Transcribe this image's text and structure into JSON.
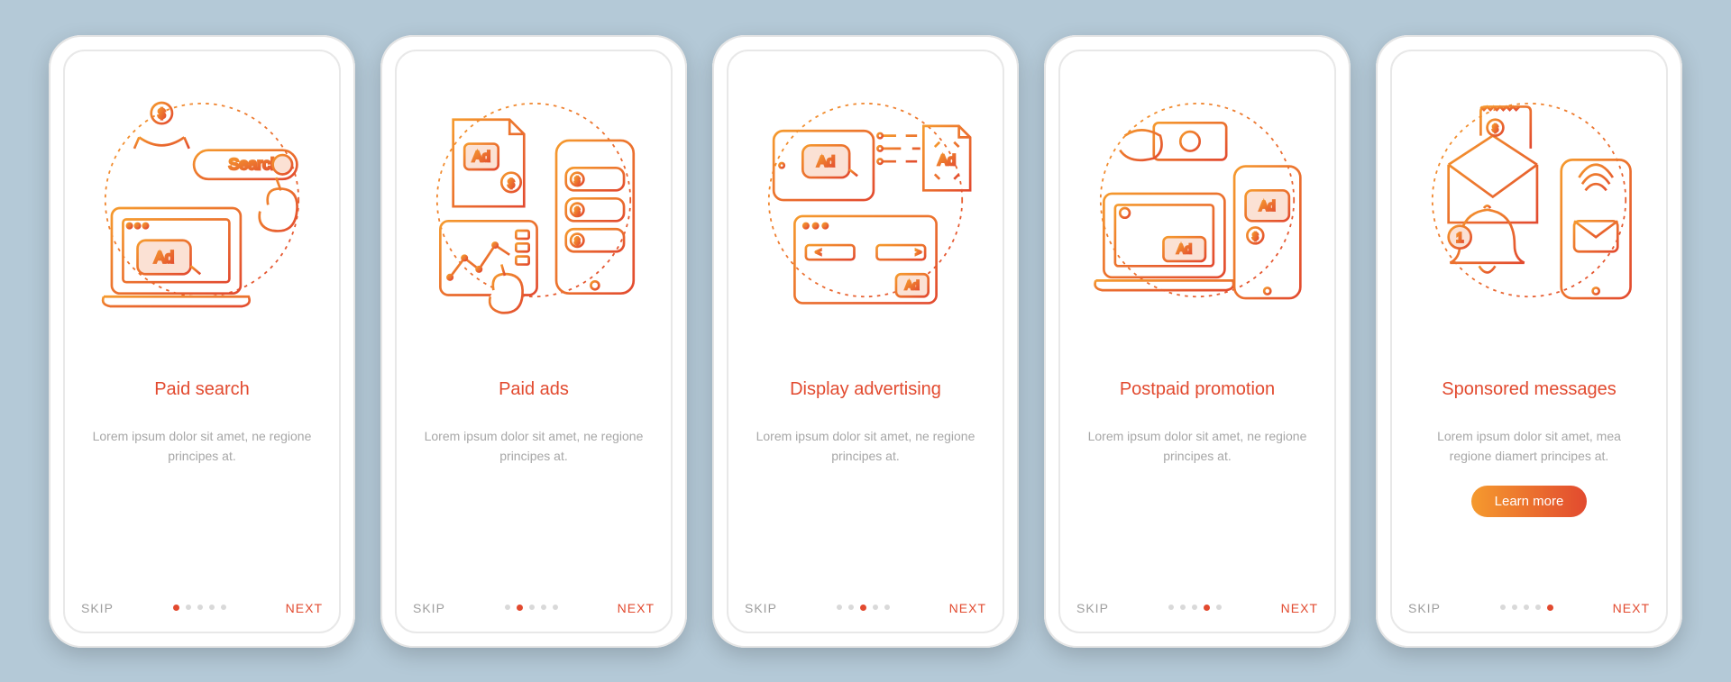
{
  "common": {
    "skip": "SKIP",
    "next": "NEXT",
    "learn_more": "Learn more",
    "lorem": "Lorem ipsum dolor sit amet, ne regione principes at.",
    "lorem_long": "Lorem ipsum dolor sit amet, mea regione diamert principes at.",
    "ad_label": "Ad",
    "search_label": "Search",
    "notification_count": "1",
    "total_dots": 5
  },
  "screens": [
    {
      "title": "Paid search",
      "active_dot": 0,
      "desc_key": "lorem"
    },
    {
      "title": "Paid ads",
      "active_dot": 1,
      "desc_key": "lorem"
    },
    {
      "title": "Display advertising",
      "active_dot": 2,
      "desc_key": "lorem"
    },
    {
      "title": "Postpaid promotion",
      "active_dot": 3,
      "desc_key": "lorem"
    },
    {
      "title": "Sponsored messages",
      "active_dot": 4,
      "desc_key": "lorem_long",
      "has_learn_more": true
    }
  ]
}
